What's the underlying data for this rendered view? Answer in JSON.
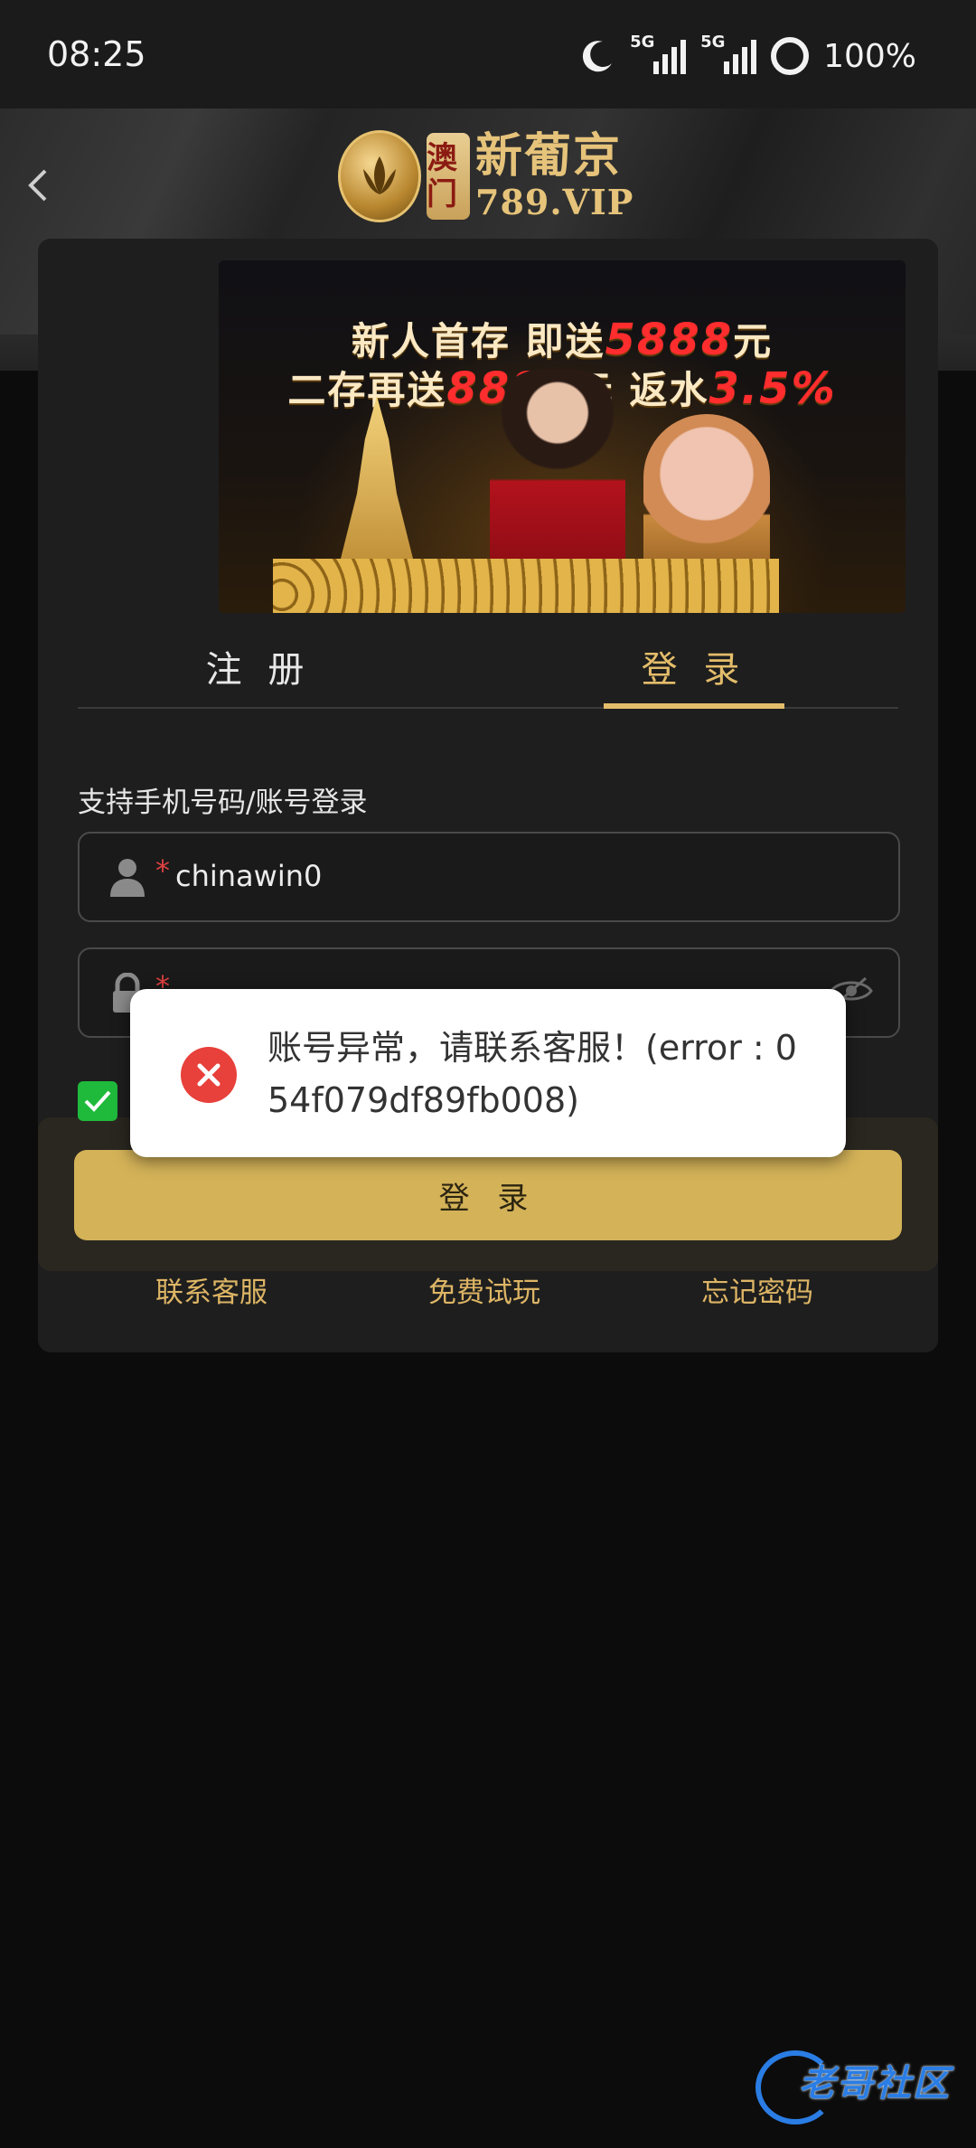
{
  "status_bar": {
    "time": "08:25",
    "sim1_label": "5G",
    "sim2_label": "5G",
    "battery": "100%"
  },
  "header": {
    "logo": {
      "seal_text": "澳门",
      "main_text": "新葡京",
      "sub_text": "789.VIP"
    }
  },
  "banner": {
    "line1_prefix": "新人首存 即送",
    "line1_amount": "5888",
    "line1_suffix": "元",
    "line2_prefix": "二存再送",
    "line2_amount": "8888",
    "line2_mid": "元 返水",
    "line2_rate": "3.5%"
  },
  "tabs": {
    "register": "注 册",
    "login": "登 录",
    "active": "login"
  },
  "form": {
    "hint": "支持手机号码/账号登录",
    "username_required_mark": "*",
    "username_value": "chinawin0",
    "password_required_mark": "*",
    "agree_checked": true,
    "login_button": "登 录"
  },
  "links": {
    "contact_service": "联系客服",
    "free_trial": "免费试玩",
    "forgot_password": "忘记密码"
  },
  "toast": {
    "message": "账号异常，请联系客服！(error : 054f079df89fb008)"
  },
  "watermark": {
    "text": "老哥社区"
  },
  "colors": {
    "accent_gold": "#d3b258",
    "tab_active": "#e4bd6a",
    "error_red": "#e8403a",
    "checkbox_green": "#1fba3c"
  },
  "icons": [
    "moon-icon",
    "signal-icon",
    "battery-icon",
    "back-arrow-icon",
    "user-icon",
    "lock-icon",
    "eye-off-icon",
    "check-icon",
    "error-icon"
  ]
}
